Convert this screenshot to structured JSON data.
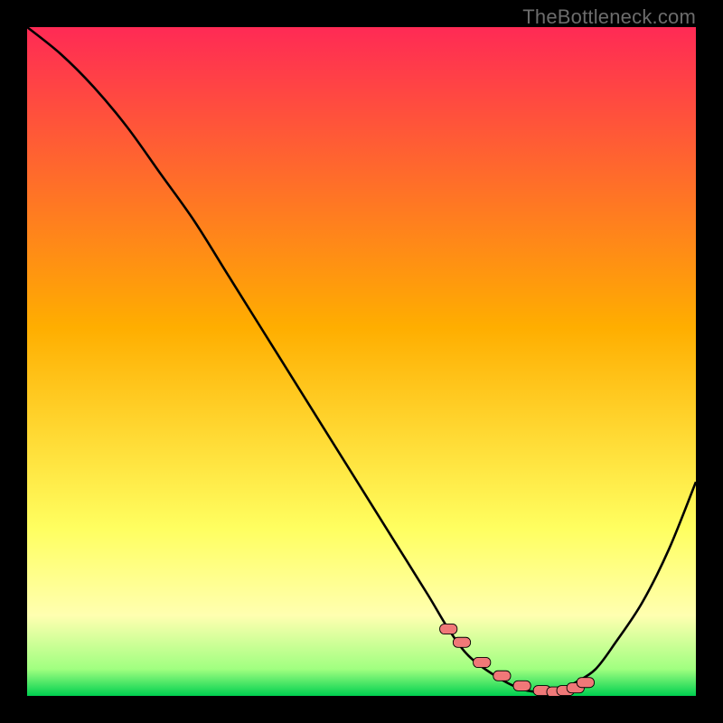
{
  "watermark": "TheBottleneck.com",
  "colors": {
    "background": "#000000",
    "watermark_text": "#6c6c6c",
    "curve_stroke": "#000000",
    "marker_fill": "#f07878",
    "marker_stroke": "#000000",
    "gradient_top": "#ff2a55",
    "gradient_mid_upper": "#ffae00",
    "gradient_mid_lower": "#ffff60",
    "gradient_yellow": "#ffffb0",
    "gradient_green_light": "#a0ff80",
    "gradient_green": "#00d050"
  },
  "chart_data": {
    "type": "line",
    "title": "",
    "xlabel": "",
    "ylabel": "",
    "xlim": [
      0,
      100
    ],
    "ylim": [
      0,
      100
    ],
    "grid": false,
    "series": [
      {
        "name": "bottleneck-curve",
        "x": [
          0,
          5,
          10,
          15,
          20,
          25,
          30,
          35,
          40,
          45,
          50,
          55,
          60,
          63,
          66,
          70,
          74,
          78,
          80,
          82,
          85,
          88,
          92,
          96,
          100
        ],
        "y": [
          100,
          96,
          91,
          85,
          78,
          71,
          63,
          55,
          47,
          39,
          31,
          23,
          15,
          10,
          6,
          3,
          1,
          0.5,
          1,
          2,
          4,
          8,
          14,
          22,
          32
        ]
      }
    ],
    "markers": {
      "name": "bottom-markers",
      "shape": "rounded-rect",
      "x": [
        63,
        65,
        68,
        71,
        74,
        77,
        79,
        80.5,
        82,
        83.5
      ],
      "y": [
        10,
        8,
        5,
        3,
        1.5,
        0.8,
        0.6,
        0.8,
        1.2,
        2.0
      ]
    },
    "gradient_stops": [
      {
        "pct": 0,
        "key": "gradient_top"
      },
      {
        "pct": 45,
        "key": "gradient_mid_upper"
      },
      {
        "pct": 75,
        "key": "gradient_mid_lower"
      },
      {
        "pct": 88,
        "key": "gradient_yellow"
      },
      {
        "pct": 96,
        "key": "gradient_green_light"
      },
      {
        "pct": 100,
        "key": "gradient_green"
      }
    ]
  }
}
